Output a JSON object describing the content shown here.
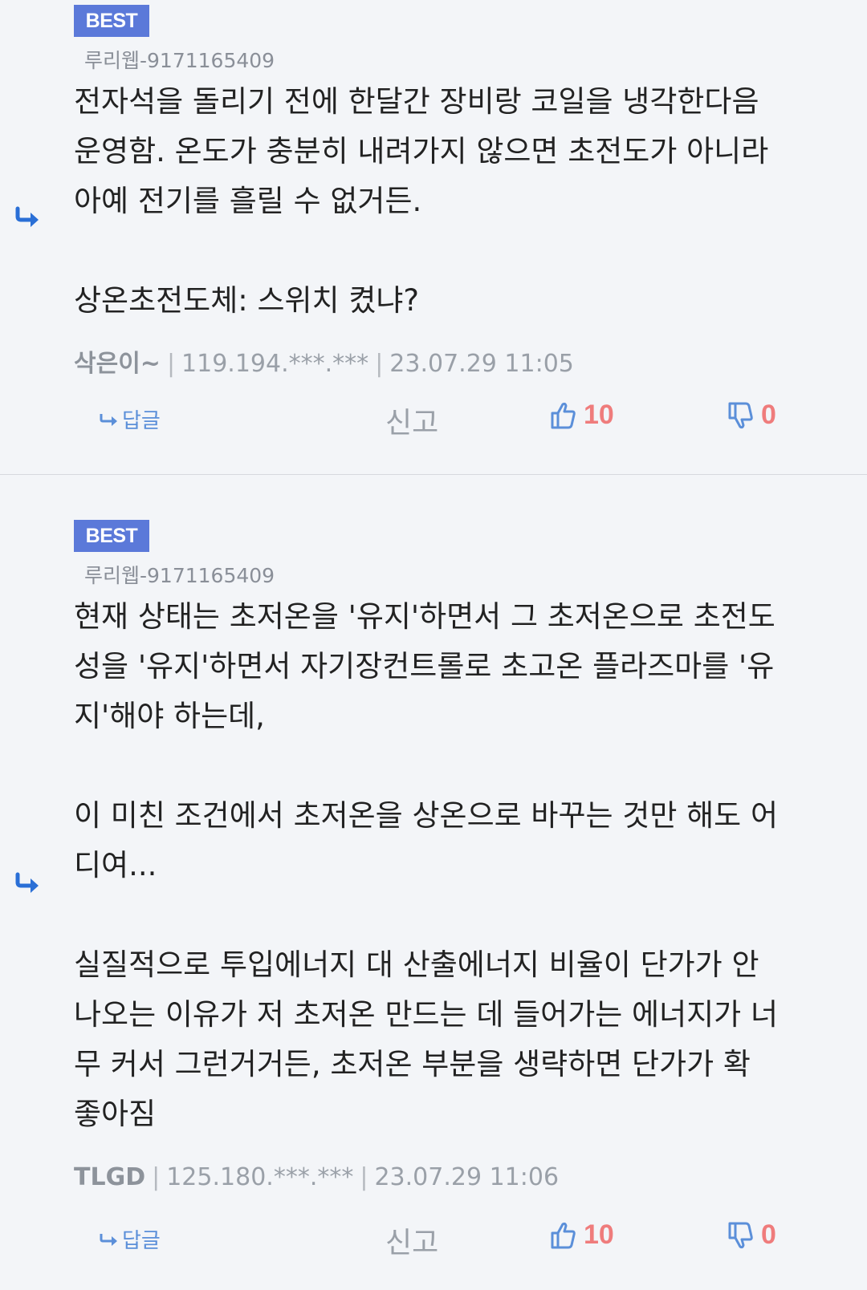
{
  "comments": [
    {
      "badge": "BEST",
      "source": "루리웹-9171165409",
      "body": "전자석을 돌리기 전에 한달간 장비랑 코일을 냉각한다음\n운영함. 온도가 충분히 내려가지 않으면 초전도가 아니라\n아예 전기를 흘릴 수 없거든.\n\n상온초전도체: 스위치 켰냐?",
      "author": "삭은이~",
      "ip": "119.194.***.***",
      "date": "23.07.29 11:05",
      "reply_label": "답글",
      "report_label": "신고",
      "likes": "10",
      "dislikes": "0"
    },
    {
      "badge": "BEST",
      "source": "루리웹-9171165409",
      "body": "현재 상태는 초저온을 '유지'하면서 그 초저온으로 초전도\n성을 '유지'하면서 자기장컨트롤로 초고온 플라즈마를 '유\n지'해야 하는데,\n\n이 미친 조건에서 초저온을 상온으로 바꾸는 것만 해도 어\n디여...\n\n실질적으로 투입에너지 대 산출에너지 비율이 단가가 안\n나오는 이유가 저 초저온 만드는 데 들어가는 에너지가 너\n무 커서 그런거거든, 초저온 부분을 생략하면 단가가 확\n좋아짐",
      "author": "TLGD",
      "ip": "125.180.***.***",
      "date": "23.07.29 11:06",
      "reply_label": "답글",
      "report_label": "신고",
      "likes": "10",
      "dislikes": "0"
    }
  ]
}
